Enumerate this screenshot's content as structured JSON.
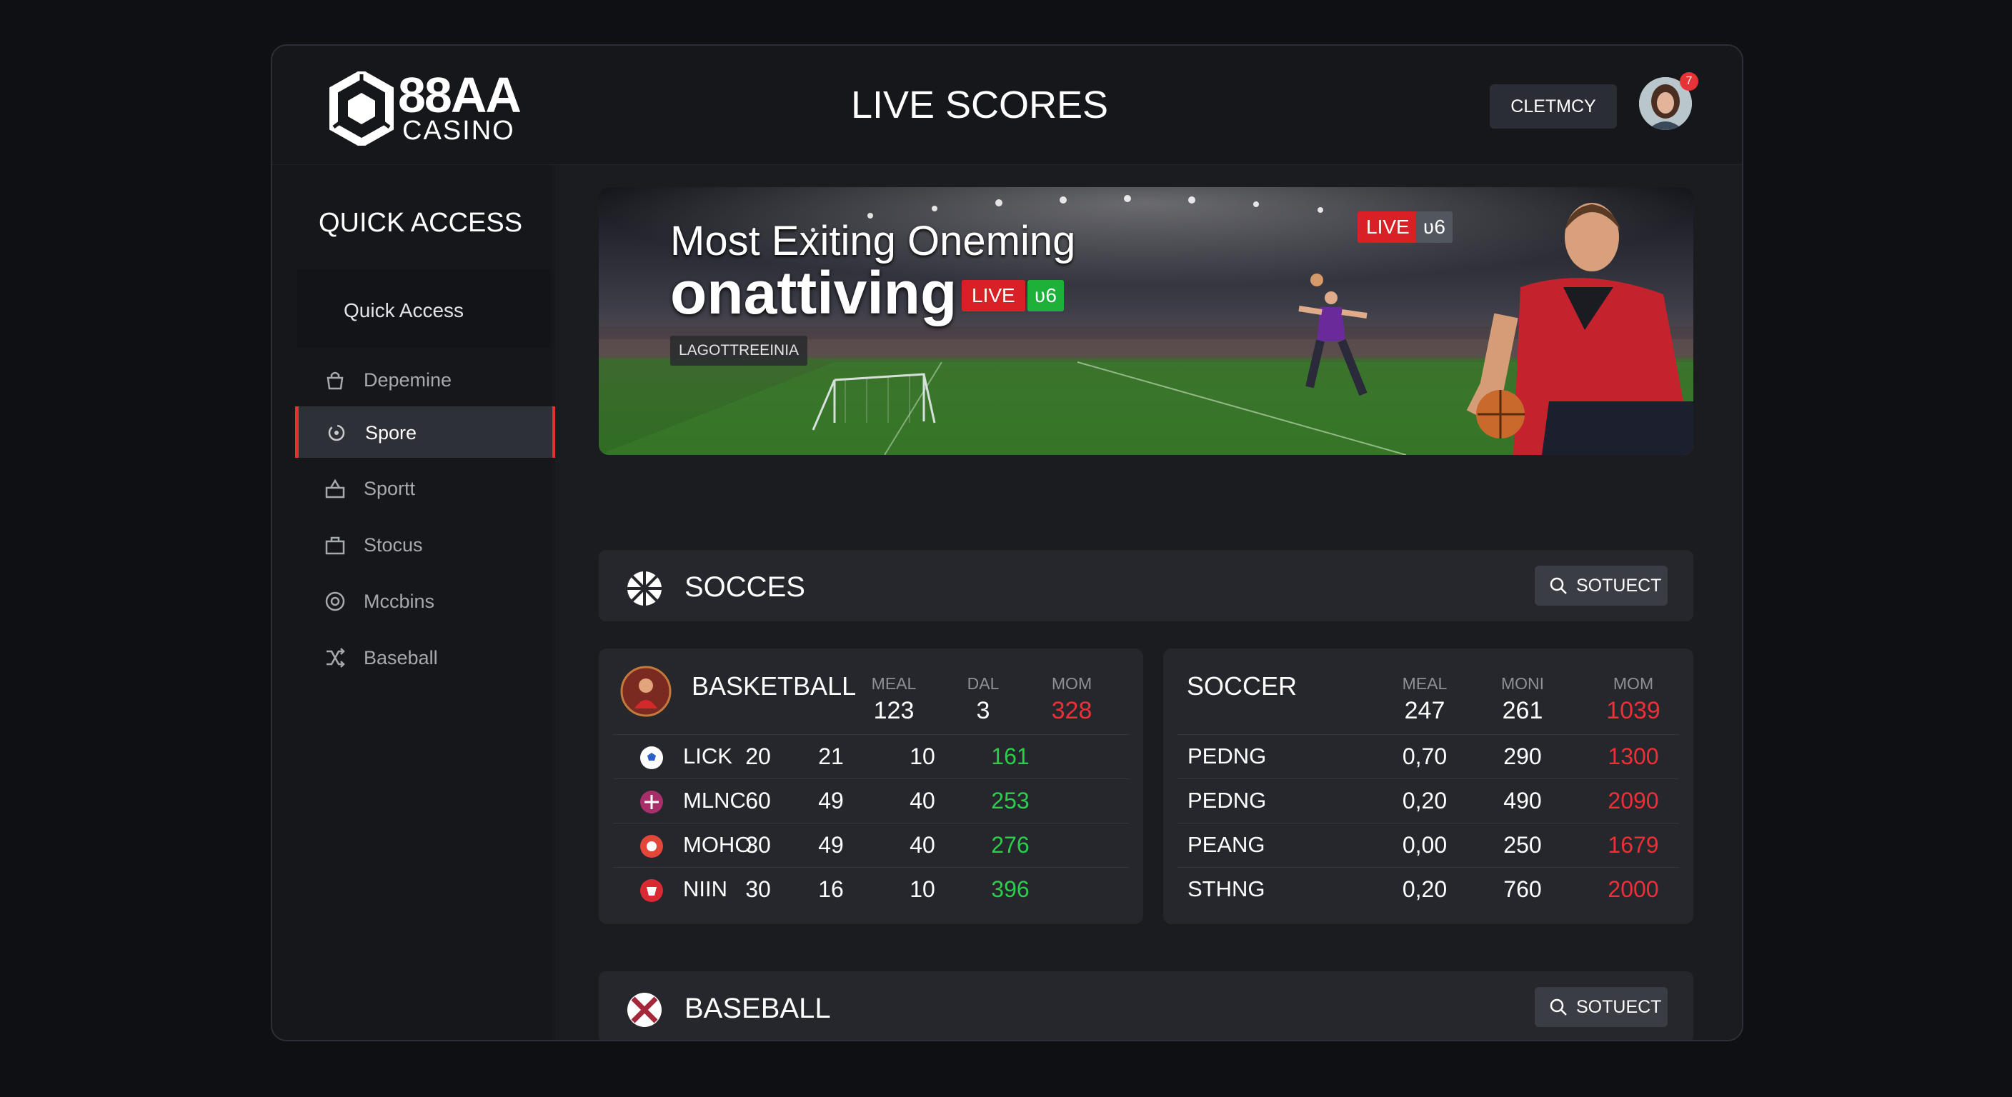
{
  "header": {
    "logo_top": "88AA",
    "logo_bottom": "CASINO",
    "title": "LIVE SCORES",
    "button": "CLETMCY",
    "badge": "7"
  },
  "sidebar": {
    "heading": "QUICK ACCESS",
    "sub": "Quick Access",
    "items": [
      {
        "label": "Depemine",
        "icon": "bag-icon"
      },
      {
        "label": "Spore",
        "icon": "refresh-icon"
      },
      {
        "label": "Sportt",
        "icon": "basket-icon"
      },
      {
        "label": "Stocus",
        "icon": "briefcase-icon"
      },
      {
        "label": "Mccbins",
        "icon": "coin-icon"
      },
      {
        "label": "Baseball",
        "icon": "shuffle-icon"
      }
    ]
  },
  "banner": {
    "line1": "Most Exiting Oneming",
    "line2": "onattiving",
    "live": "LIVE",
    "live_num": "ʋ6",
    "live2": "LIVE",
    "live_num2": "ʋ6",
    "tag": "LAGOTTREEINIA"
  },
  "section1": {
    "title": "SOCCES",
    "button": "SOTUECT"
  },
  "section2": {
    "title": "BASEBALL",
    "button": "SOTUECT"
  },
  "basketball": {
    "title": "BASKETBALL",
    "columns": [
      {
        "label": "MEAL",
        "value": "123"
      },
      {
        "label": "DAL",
        "value": "3"
      },
      {
        "label": "MOM",
        "value": "328"
      }
    ],
    "rows": [
      {
        "name": "LICK",
        "c1": "20",
        "c2": "21",
        "c3": "10",
        "c4": "161"
      },
      {
        "name": "MLNC",
        "c1": "60",
        "c2": "49",
        "c3": "40",
        "c4": "253"
      },
      {
        "name": "MOHO",
        "c1": "30",
        "c2": "49",
        "c3": "40",
        "c4": "276"
      },
      {
        "name": "NIIN",
        "c1": "30",
        "c2": "16",
        "c3": "10",
        "c4": "396"
      }
    ]
  },
  "soccer": {
    "title": "SOCCER",
    "columns": [
      {
        "label": "MEAL",
        "value": "247"
      },
      {
        "label": "MONI",
        "value": "261"
      },
      {
        "label": "MOM",
        "value": "1039"
      }
    ],
    "rows": [
      {
        "name": "PEDNG",
        "c1": "0,70",
        "c2": "290",
        "c3": "1300"
      },
      {
        "name": "PEDNG",
        "c1": "0,20",
        "c2": "490",
        "c3": "2090"
      },
      {
        "name": "PEANG",
        "c1": "0,00",
        "c2": "250",
        "c3": "1679"
      },
      {
        "name": "STHNG",
        "c1": "0,20",
        "c2": "760",
        "c3": "2000"
      }
    ]
  },
  "colors": {
    "accent": "#e03236",
    "positive": "#2ccd4c",
    "negative": "#ef2f37"
  }
}
